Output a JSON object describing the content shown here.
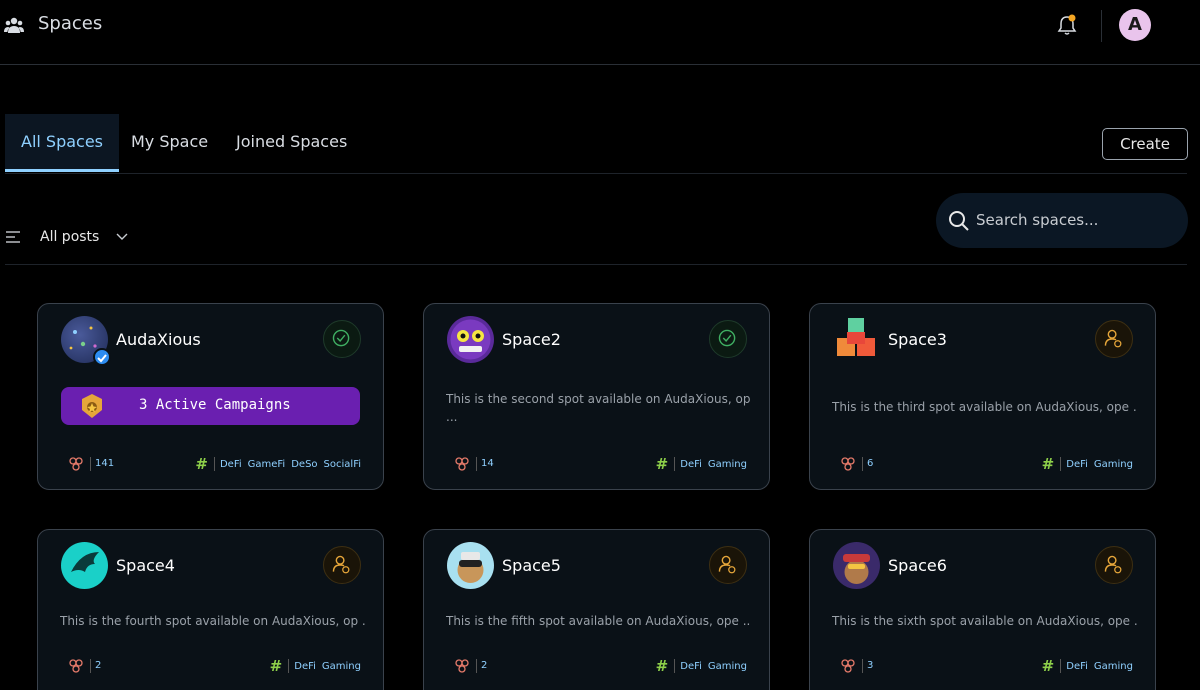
{
  "header": {
    "title": "Spaces",
    "avatar_initial": "A"
  },
  "tabs": [
    {
      "label": "All Spaces",
      "active": true
    },
    {
      "label": "My Space",
      "active": false
    },
    {
      "label": "Joined Spaces",
      "active": false
    }
  ],
  "create_label": "Create",
  "filter": {
    "label": "All posts"
  },
  "search": {
    "placeholder": "Search spaces..."
  },
  "colors": {
    "accent": "#8fd0ff",
    "campaign": "#6a1fb0",
    "tag_hash": "#8ed04a",
    "verified": "#2d8cf0"
  },
  "cards": [
    {
      "name": "AudaXious",
      "verified": true,
      "status": "check-circle-icon",
      "campaign_label": "3 Active Campaigns",
      "description": "",
      "members": "141",
      "tags": [
        "DeFi",
        "GameFi",
        "DeSo",
        "SocialFi"
      ]
    },
    {
      "name": "Space2",
      "verified": false,
      "status": "check-circle-icon",
      "description": "This is the second spot available on AudaXious, op ...",
      "members": "14",
      "tags": [
        "DeFi",
        "Gaming"
      ]
    },
    {
      "name": "Space3",
      "verified": false,
      "status": "join-user-icon",
      "description": "This is the third spot available on AudaXious, ope ...",
      "members": "6",
      "tags": [
        "DeFi",
        "Gaming"
      ]
    },
    {
      "name": "Space4",
      "verified": false,
      "status": "join-user-icon",
      "description": "This is the fourth spot available on AudaXious, op ...",
      "members": "2",
      "tags": [
        "DeFi",
        "Gaming"
      ]
    },
    {
      "name": "Space5",
      "verified": false,
      "status": "join-user-icon",
      "description": "This is the fifth spot available on AudaXious, ope ...",
      "members": "2",
      "tags": [
        "DeFi",
        "Gaming"
      ]
    },
    {
      "name": "Space6",
      "verified": false,
      "status": "join-user-icon",
      "description": "This is the sixth spot available on AudaXious, ope ...",
      "members": "3",
      "tags": [
        "DeFi",
        "Gaming"
      ]
    }
  ]
}
